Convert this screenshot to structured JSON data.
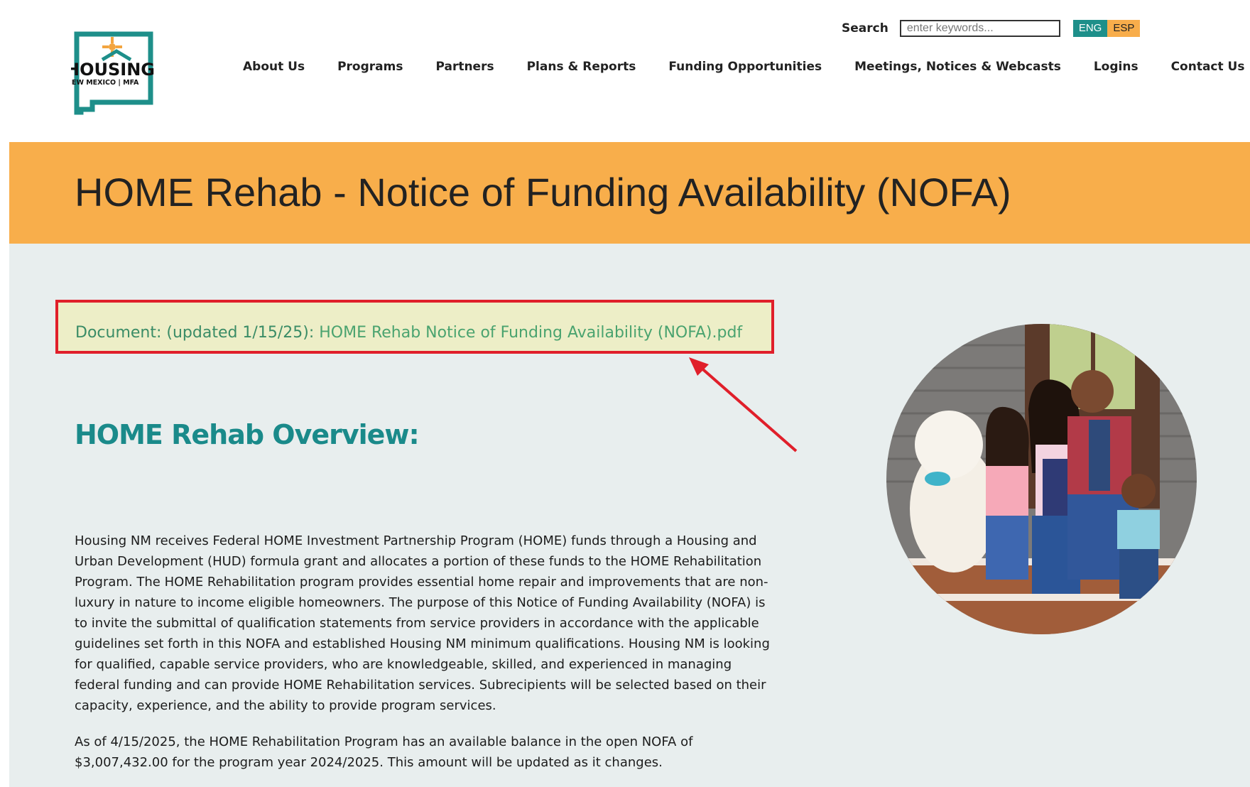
{
  "logo": {
    "word": "HOUSING",
    "sub": "NEW MEXICO | MFA"
  },
  "search": {
    "label": "Search",
    "placeholder": "enter keywords..."
  },
  "lang": {
    "eng": "ENG",
    "esp": "ESP"
  },
  "nav": [
    {
      "label": "About Us"
    },
    {
      "label": "Programs"
    },
    {
      "label": "Partners"
    },
    {
      "label": "Plans & Reports"
    },
    {
      "label": "Funding Opportunities"
    },
    {
      "label": "Meetings, Notices & Webcasts"
    },
    {
      "label": "Logins"
    },
    {
      "label": "Contact Us"
    }
  ],
  "banner": {
    "title": "HOME Rehab - Notice of Funding Availability (NOFA)"
  },
  "document": {
    "prefix": "Document: (updated 1/15/25): ",
    "link": "HOME Rehab Notice of Funding Availability (NOFA).pdf"
  },
  "overview": {
    "heading": "HOME Rehab Overview:",
    "p1": "Housing NM receives Federal HOME Investment Partnership Program (HOME) funds through a Housing and Urban Development (HUD) formula grant and allocates a portion of these funds to the HOME Rehabilitation Program. The HOME Rehabilitation program provides essential home repair and improvements that are non-luxury in nature to income eligible homeowners. The purpose of this Notice of Funding Availability (NOFA) is to invite the submittal of qualification statements from service providers in accordance with the applicable guidelines set forth in this NOFA and established Housing NM minimum qualifications. Housing NM is looking for qualified, capable service providers, who are knowledgeable, skilled, and experienced in managing federal funding and can provide HOME Rehabilitation services. Subrecipients will be selected based on their capacity, experience, and the ability to provide program services.",
    "p2": "As of 4/15/2025, the HOME Rehabilitation Program has an available balance in the open NOFA of $3,007,432.00 for the program year 2024/2025. This amount will be updated as it changes."
  },
  "colors": {
    "banner": "#f8ae4b",
    "teal": "#1e8f8a",
    "highlight_border": "#e01f2a",
    "link": "#4aa36f",
    "main_bg": "#e8eeee"
  },
  "icons": [
    "housing-nm-logo",
    "annotation-arrow-icon",
    "family-photo"
  ]
}
